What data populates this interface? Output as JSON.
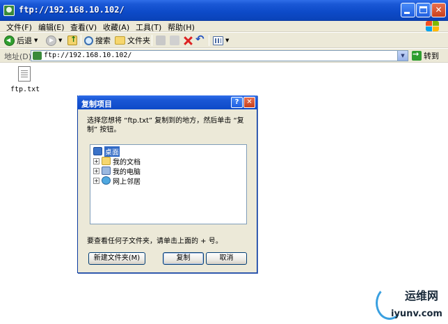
{
  "window": {
    "title": "ftp://192.168.10.102/"
  },
  "menu": {
    "file": "文件(F)",
    "edit": "编辑(E)",
    "view": "查看(V)",
    "favorites": "收藏(A)",
    "tools": "工具(T)",
    "help": "帮助(H)"
  },
  "toolbar": {
    "back": "后退",
    "search": "搜索",
    "folders": "文件夹"
  },
  "address": {
    "label": "地址(D)",
    "value": "ftp://192.168.10.102/",
    "go": "转到"
  },
  "files": [
    {
      "name": "ftp.txt"
    }
  ],
  "dialog": {
    "title": "复制项目",
    "help": "?",
    "close": "✕",
    "instruction": "选择您想将 “ftp.txt” 复制到的地方，然后单击 “复制” 按钮。",
    "tree": [
      {
        "label": "桌面",
        "selected": true
      },
      {
        "label": "我的文档"
      },
      {
        "label": "我的电脑"
      },
      {
        "label": "网上邻居"
      }
    ],
    "hint": "要查看任何子文件夹，请单击上面的 + 号。",
    "buttons": {
      "new_folder": "新建文件夹(M)",
      "copy": "复制",
      "cancel": "取消"
    }
  },
  "watermark": {
    "cn": "运维网",
    "en": "iyunv.com"
  }
}
